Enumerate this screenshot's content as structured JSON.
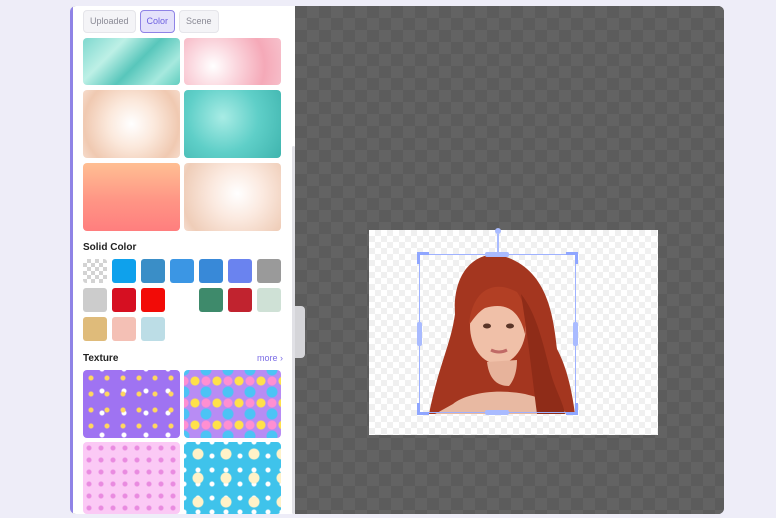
{
  "tabs": [
    {
      "label": "Uploaded",
      "active": false
    },
    {
      "label": "Color",
      "active": true
    },
    {
      "label": "Scene",
      "active": false
    }
  ],
  "solid_color": {
    "title": "Solid Color",
    "swatches": [
      "transparent",
      "#0ea1ec",
      "#3a8ec7",
      "#3b96e4",
      "#3889d8",
      "#6a83ef",
      "#9a9a9a",
      "#cccccc",
      "#d60f21",
      "#f20b07",
      "#ffffff",
      "#3e8a6b",
      "#c1232f",
      "#cfe1d6",
      "#dfbb7a",
      "#f4c0b5",
      "#bcdde6"
    ]
  },
  "texture": {
    "title": "Texture",
    "more_label": "more ›"
  },
  "icons": {
    "more_chevron": "chevron-right-icon",
    "rotate_handle": "rotate-handle-icon"
  },
  "colors": {
    "accent": "#7b6de6",
    "workspace": "#5c5c5c",
    "selection": "#9fb2ff"
  }
}
